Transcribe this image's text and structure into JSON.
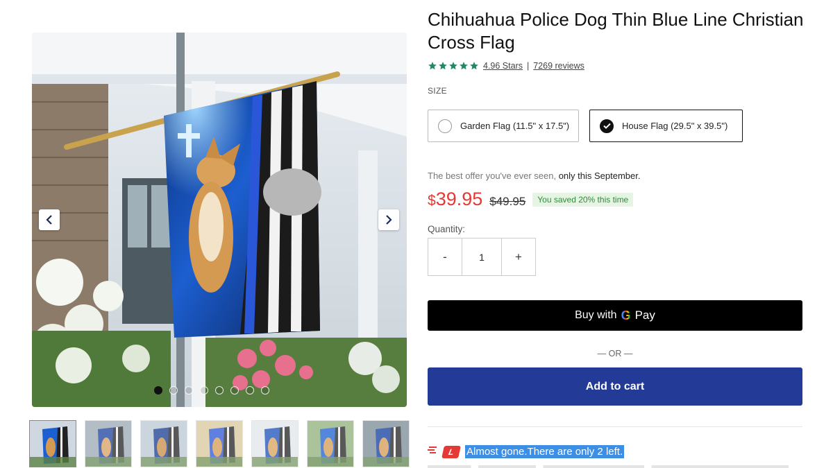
{
  "product": {
    "title": "Chihuahua Police Dog Thin Blue Line Christian Cross Flag",
    "rating_text": "4.96 Stars",
    "rating_separator": "|",
    "reviews_text": "7269 reviews",
    "stars": 5,
    "star_color": "#1e8a6a"
  },
  "size": {
    "label": "SIZE",
    "options": [
      {
        "label": "Garden Flag (11.5\" x 17.5\")",
        "selected": false
      },
      {
        "label": "House Flag (29.5\" x 39.5\")",
        "selected": true
      }
    ]
  },
  "offer": {
    "text_prefix": "The best offer you've ever seen,",
    "text_highlight": "only this September.",
    "currency": "$",
    "price": "39.95",
    "old_price": "$49.95",
    "saved": "You saved 20% this time",
    "price_color": "#e53935"
  },
  "quantity": {
    "label": "Quantity:",
    "minus": "-",
    "value": "1",
    "plus": "+"
  },
  "actions": {
    "gpay_prefix": "Buy with",
    "gpay_g": "G",
    "gpay_suffix": "Pay",
    "or": "— OR —",
    "add_to_cart": "Add to cart",
    "cart_color": "#233a96"
  },
  "stock": {
    "badge": "L",
    "text_a": "Almost gone.",
    "text_b": "There are only 2 left."
  },
  "gallery": {
    "dot_count": 8,
    "active_dot": 0,
    "thumbnail_count": 7,
    "active_thumbnail": 0
  }
}
